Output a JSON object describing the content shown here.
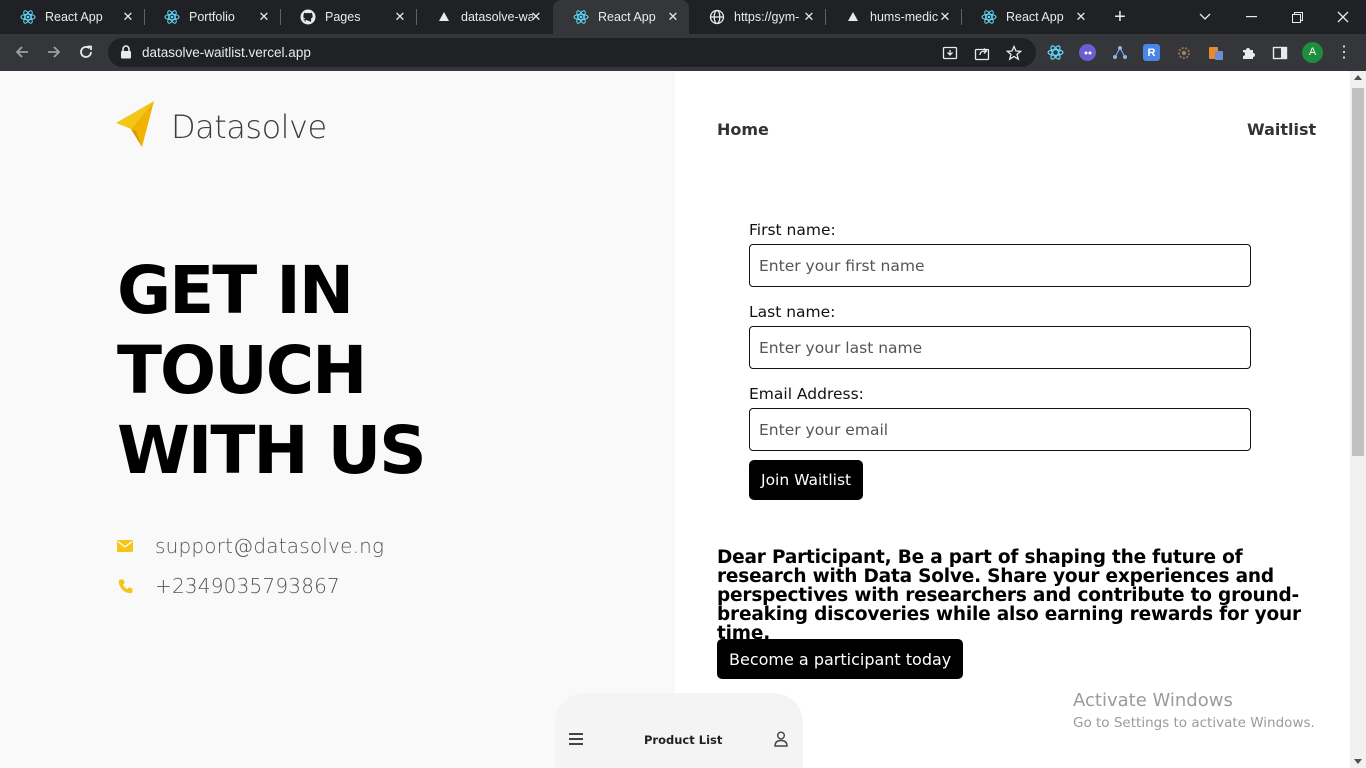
{
  "browser": {
    "tabs": [
      {
        "title": "React App",
        "icon": "react-icon",
        "active": false
      },
      {
        "title": "Portfolio",
        "icon": "react-icon",
        "active": false
      },
      {
        "title": "Pages",
        "icon": "github-icon",
        "active": false
      },
      {
        "title": "datasolve-wa",
        "icon": "vercel-icon",
        "active": false
      },
      {
        "title": "React App",
        "icon": "react-icon",
        "active": true
      },
      {
        "title": "https://gym-",
        "icon": "globe-icon",
        "active": false
      },
      {
        "title": "hums-medic",
        "icon": "vercel-icon",
        "active": false
      },
      {
        "title": "React App",
        "icon": "react-icon",
        "active": false
      }
    ],
    "new_tab": "+",
    "address": "datasolve-waitlist.vercel.app",
    "profile_initial": "A",
    "extensions": [
      "R"
    ]
  },
  "page": {
    "logo_text": "Datasolve",
    "hero": [
      "GET IN",
      "TOUCH",
      "WITH US"
    ],
    "contact": {
      "email": "support@datasolve.ng",
      "phone": "+2349035793867"
    },
    "nav": {
      "home": "Home",
      "waitlist": "Waitlist"
    },
    "form": {
      "first_name_label": "First name:",
      "first_name_placeholder": "Enter your first name",
      "last_name_label": "Last name:",
      "last_name_placeholder": "Enter your last name",
      "email_label": "Email Address:",
      "email_placeholder": "Enter your email",
      "submit_label": "Join Waitlist"
    },
    "participant": {
      "text": "Dear Participant, Be a part of shaping the future of research with Data Solve. Share your experiences and perspectives with researchers and contribute to ground-breaking discoveries while also earning rewards for your time.",
      "button_label": "Become a participant today"
    },
    "bottom_nav": {
      "title": "Product List"
    }
  },
  "watermark": {
    "line1": "Activate Windows",
    "line2": "Go to Settings to activate Windows."
  },
  "colors": {
    "accent": "#f5c518",
    "button_bg": "#000000",
    "left_panel_bg": "#f9f9f9"
  }
}
